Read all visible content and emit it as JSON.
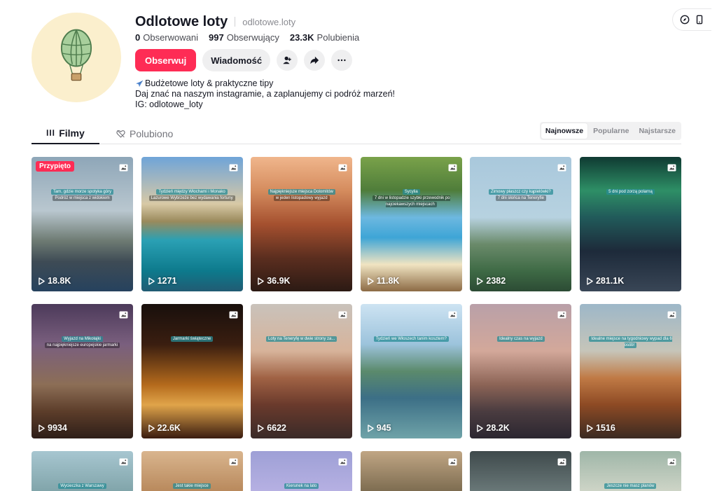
{
  "profile": {
    "display_name": "Odlotowe loty",
    "username": "odlotowe.loty",
    "stats": [
      {
        "value": "0",
        "label": "Obserwowani"
      },
      {
        "value": "997",
        "label": "Obserwujący"
      },
      {
        "value": "23.3K",
        "label": "Polubienia"
      }
    ],
    "bio": [
      "Budżetowe loty & praktyczne tipy",
      "Daj znać na naszym instagramie, a zaplanujemy ci podróż marzeń!",
      "IG: odlotowe_loty"
    ]
  },
  "actions": {
    "follow_label": "Obserwuj",
    "message_label": "Wiadomość"
  },
  "tabs": {
    "films": "Filmy",
    "liked": "Polubiono"
  },
  "sort": {
    "options": [
      "Najnowsze",
      "Popularne",
      "Najstarsze"
    ],
    "selected": "Najnowsze"
  },
  "pinned_label": "Przypięto",
  "videos": [
    {
      "views": "18.8K",
      "pinned": true,
      "caption": "Tam, gdzie morze spotyka góry",
      "caption2": "Podróż w miejsca z widokiem",
      "theme": "lighthouse"
    },
    {
      "views": "1271",
      "caption": "Tydzień między Włochami i Monako",
      "caption2": "Lazurowe Wybrzeże bez wydawania fortuny",
      "theme": "coast"
    },
    {
      "views": "36.9K",
      "caption": "Najpiękniejsze miejsca Dolomitów",
      "caption2": "w jeden listopadowy wyjazd",
      "theme": "dolomites"
    },
    {
      "views": "11.8K",
      "caption": "Sycylia",
      "caption2": "7 dni w listopadzie szybki przewodnik po najciekawszych miejscach",
      "theme": "sicily"
    },
    {
      "views": "2382",
      "caption": "Zimowy płaszcz czy kąpielówki?",
      "caption2": "7 dni słońca na Teneryfie",
      "theme": "cactus"
    },
    {
      "views": "281.1K",
      "caption": "5 dni pod zorzą polarną",
      "caption2": "",
      "theme": "aurora"
    },
    {
      "views": "9934",
      "caption": "Wyjazd na Mikołajki",
      "caption2": "na najpiękniejsze europejskie jarmarki",
      "theme": "market"
    },
    {
      "views": "22.6K",
      "caption": "Jarmarki świąteczne",
      "caption2": "",
      "theme": "vienna"
    },
    {
      "views": "6622",
      "caption": "Loty na Teneryfę w dwie strony za...",
      "caption2": "",
      "theme": "teide"
    },
    {
      "views": "945",
      "caption": "Tydzień we Włoszech tanim kosztem?",
      "caption2": "",
      "theme": "lake"
    },
    {
      "views": "28.2K",
      "caption": "Idealny czas na wyjazd",
      "caption2": "",
      "theme": "cityscape"
    },
    {
      "views": "1516",
      "caption": "Idealne miejsce na tygodniowy wypad dla 6 osób!",
      "caption2": "",
      "theme": "cliff"
    },
    {
      "views": "",
      "caption": "Wycieczka z Warszawy",
      "caption2": "",
      "theme": "row3a"
    },
    {
      "views": "",
      "caption": "Jest takie miejsce",
      "caption2": "",
      "theme": "row3b"
    },
    {
      "views": "",
      "caption": "Kierunek na lato",
      "caption2": "",
      "theme": "row3c"
    },
    {
      "views": "",
      "caption": "",
      "caption2": "",
      "theme": "row3d"
    },
    {
      "views": "",
      "caption": "",
      "caption2": "",
      "theme": "row3e"
    },
    {
      "views": "",
      "caption": "Jeszcze nie masz planów",
      "caption2": "",
      "theme": "row3f"
    }
  ],
  "colors": {
    "accent": "#fe2c55",
    "text": "#161823",
    "muted": "#8a8b91"
  }
}
